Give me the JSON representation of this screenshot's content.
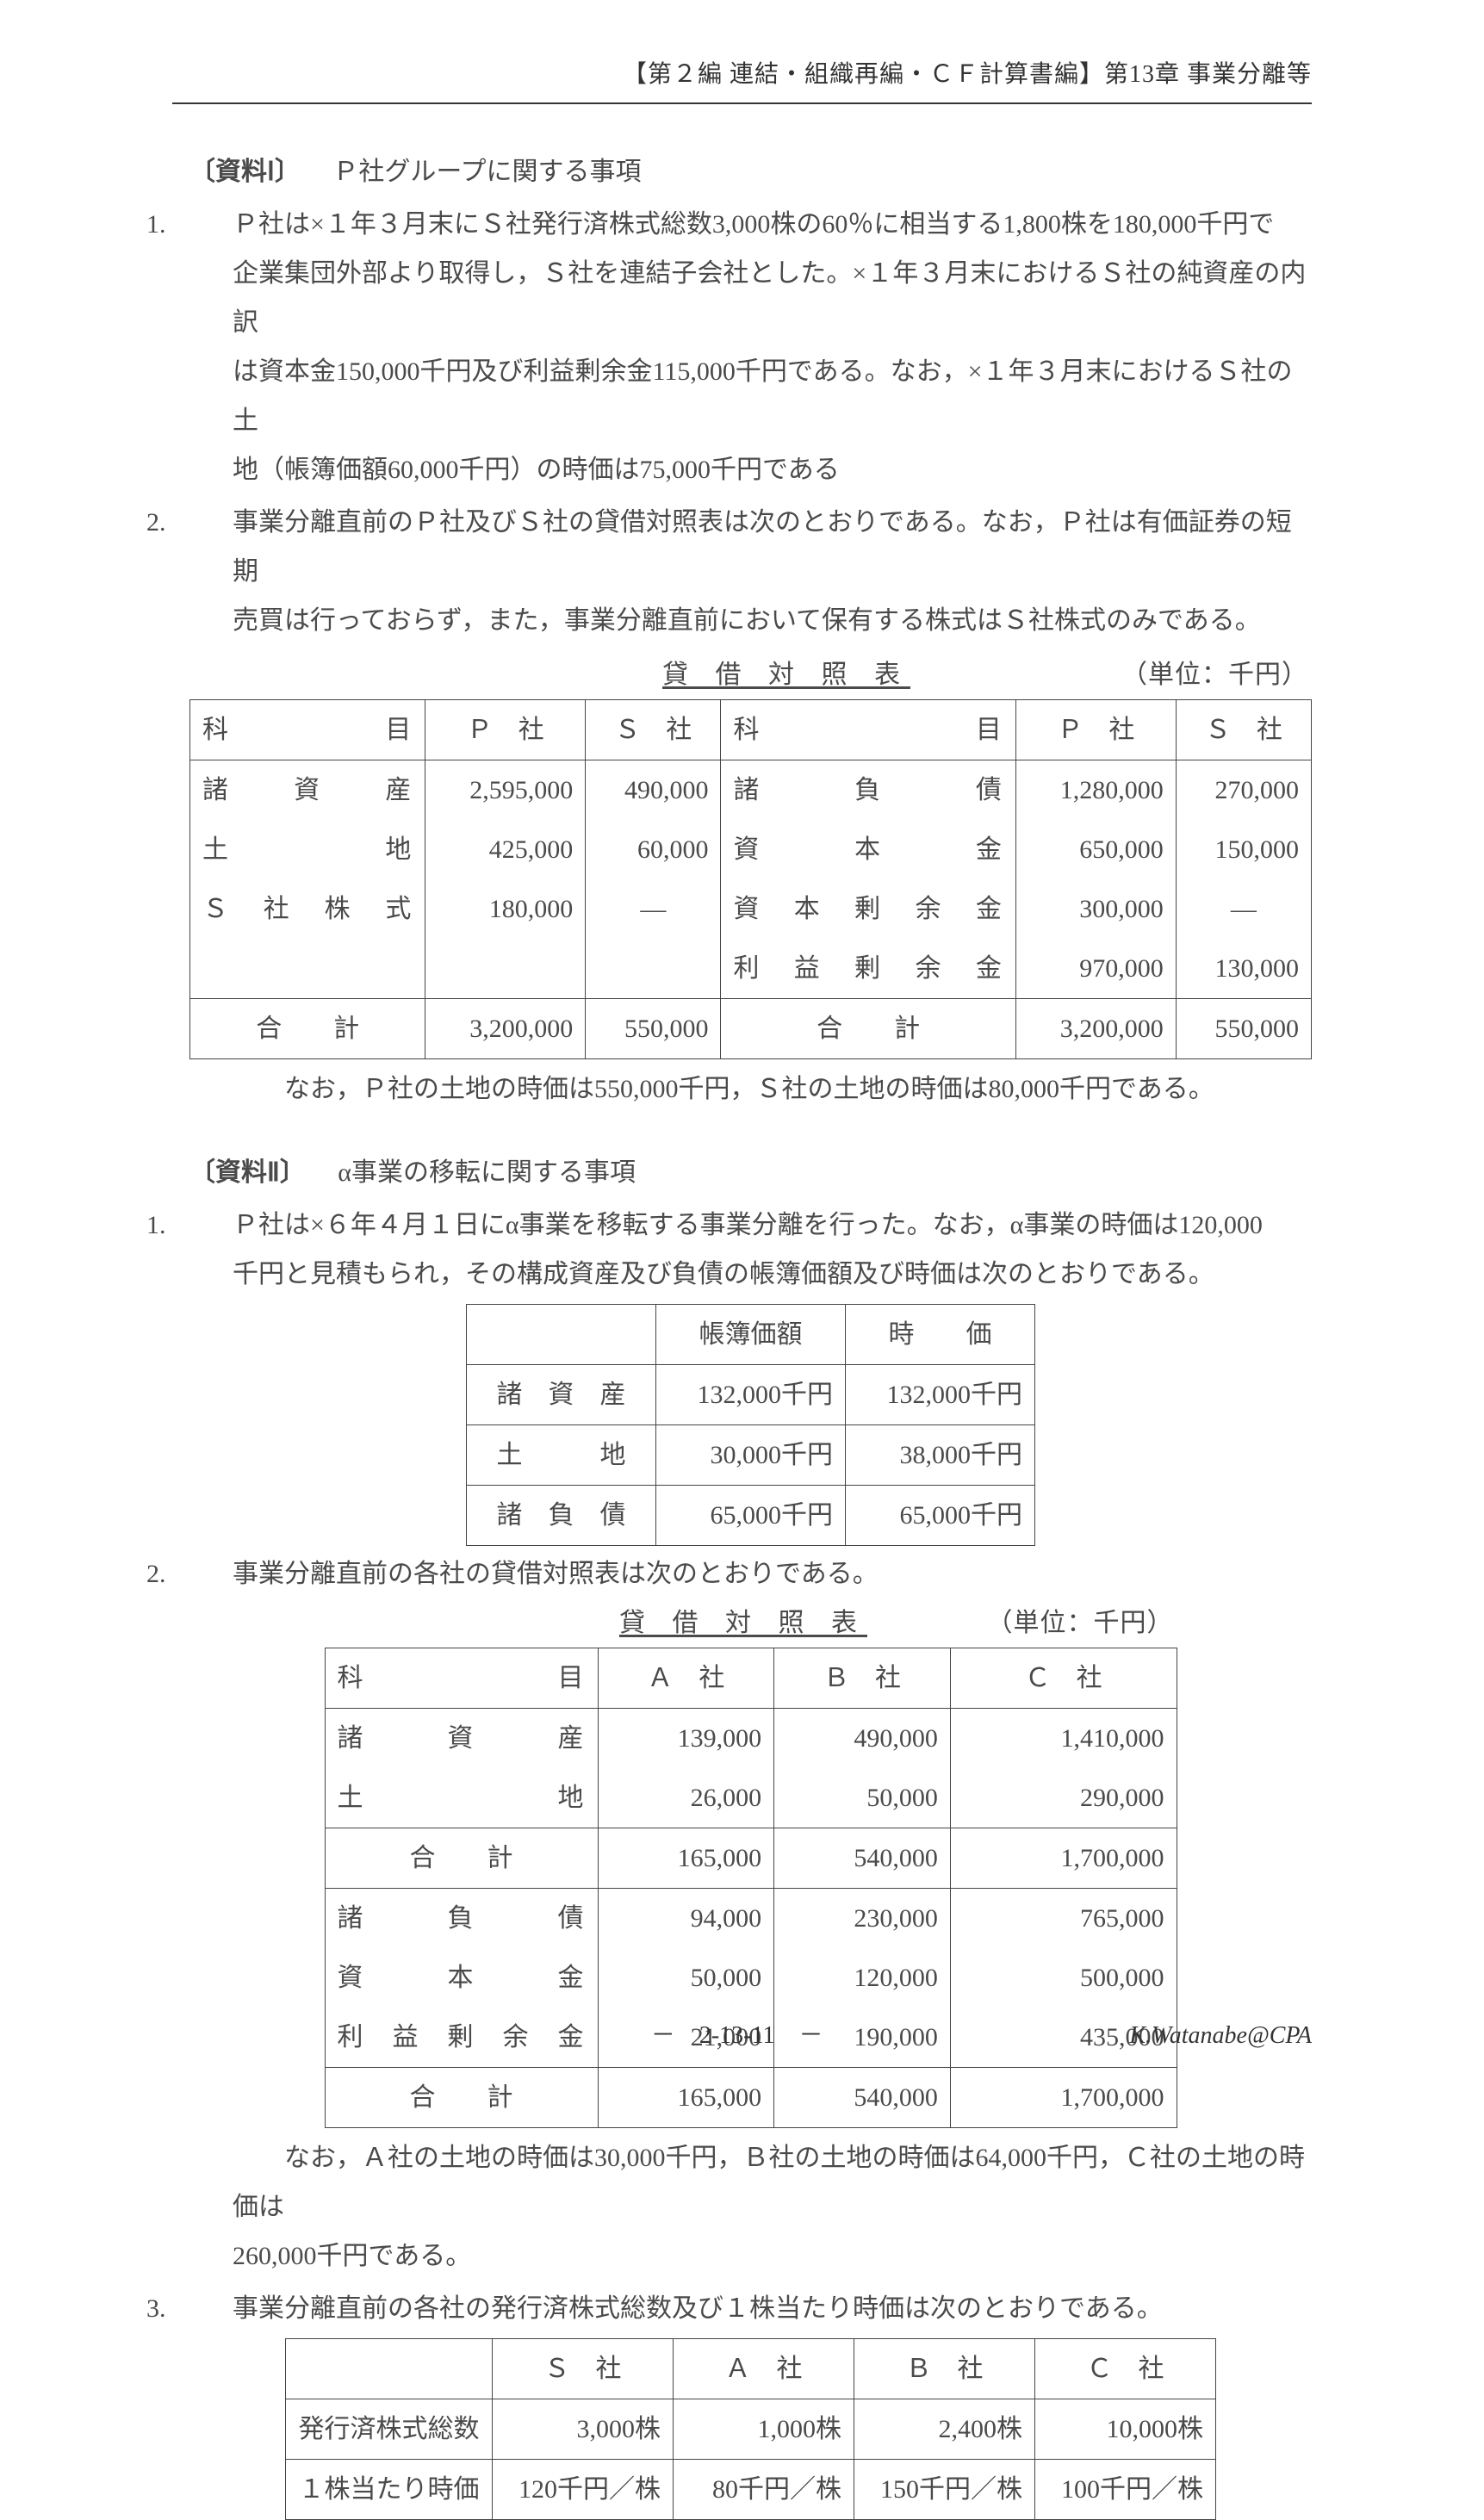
{
  "header": {
    "right": "【第２編 連結・組織再編・ＣＦ計算書編】第13章 事業分離等"
  },
  "sec1": {
    "title_prefix": "〔資料Ⅰ〕",
    "title_body": "Ｐ社グループに関する事項",
    "i1a": "Ｐ社は×１年３月末にＳ社発行済株式総数3,000株の60％に相当する1,800株を180,000千円で",
    "i1b": "企業集団外部より取得し，Ｓ社を連結子会社とした。×１年３月末におけるＳ社の純資産の内訳",
    "i1c": "は資本金150,000千円及び利益剰余金115,000千円である。なお，×１年３月末におけるＳ社の土",
    "i1d": "地（帳簿価額60,000千円）の時価は75,000千円である",
    "i2a": "事業分離直前のＰ社及びＳ社の貸借対照表は次のとおりである。なお，Ｐ社は有価証券の短期",
    "i2b": "売買は行っておらず，また，事業分離直前において保有する株式はＳ社株式のみである。",
    "note": "なお，Ｐ社の土地の時価は550,000千円，Ｓ社の土地の時価は80,000千円である。"
  },
  "tbl1": {
    "title": "貸 借 対 照 表",
    "unit": "（単位：千円）",
    "h_kamoku": "科　　目",
    "h_p": "Ｐ　社",
    "h_s": "Ｓ　社",
    "r1l": "諸　　資　　産",
    "r1p": "2,595,000",
    "r1s": "490,000",
    "r1rl": "諸　　負　　債",
    "r1rp": "1,280,000",
    "r1rs": "270,000",
    "r2l": "土　　　　　地",
    "r2p": "425,000",
    "r2s": "60,000",
    "r2rl": "資　　本　　金",
    "r2rp": "650,000",
    "r2rs": "150,000",
    "r3l": "Ｓ　社　株　式",
    "r3p": "180,000",
    "r3s": "―",
    "r3rl": "資　本　剰　余　金",
    "r3rp": "300,000",
    "r3rs": "―",
    "r4rl": "利　益　剰　余　金",
    "r4rp": "970,000",
    "r4rs": "130,000",
    "r5l": "合　　計",
    "r5p": "3,200,000",
    "r5s": "550,000",
    "r5rl": "合　　計",
    "r5rp": "3,200,000",
    "r5rs": "550,000"
  },
  "sec2": {
    "title_prefix": "〔資料Ⅱ〕",
    "title_body": "α事業の移転に関する事項",
    "i1a": "Ｐ社は×６年４月１日にα事業を移転する事業分離を行った。なお，α事業の時価は120,000",
    "i1b": "千円と見積もられ，その構成資産及び負債の帳簿価額及び時価は次のとおりである。",
    "i2": "事業分離直前の各社の貸借対照表は次のとおりである。",
    "note2a": "なお，Ａ社の土地の時価は30,000千円，Ｂ社の土地の時価は64,000千円，Ｃ社の土地の時価は",
    "note2b": "260,000千円である。",
    "i3": "事業分離直前の各社の発行済株式総数及び１株当たり時価は次のとおりである。"
  },
  "tbl2": {
    "h_book": "帳簿価額",
    "h_fair": "時　　価",
    "r1l": "諸　資　産",
    "r1b": "132,000千円",
    "r1f": "132,000千円",
    "r2l": "土　　　地",
    "r2b": "30,000千円",
    "r2f": "38,000千円",
    "r3l": "諸　負　債",
    "r3b": "65,000千円",
    "r3f": "65,000千円"
  },
  "tbl3": {
    "title": "貸 借 対 照 表",
    "unit": "（単位：千円）",
    "h_kamoku": "科　　目",
    "h_a": "Ａ　社",
    "h_b": "Ｂ　社",
    "h_c": "Ｃ　社",
    "r1l": "諸　　資　　産",
    "r1a": "139,000",
    "r1b": "490,000",
    "r1c": "1,410,000",
    "r2l": "土　　　　　地",
    "r2a": "26,000",
    "r2b": "50,000",
    "r2c": "290,000",
    "r3l": "合　　計",
    "r3a": "165,000",
    "r3b": "540,000",
    "r3c": "1,700,000",
    "r4l": "諸　　負　　債",
    "r4a": "94,000",
    "r4b": "230,000",
    "r4c": "765,000",
    "r5l": "資　　本　　金",
    "r5a": "50,000",
    "r5b": "120,000",
    "r5c": "500,000",
    "r6l": "利　益　剰　余　金",
    "r6a": "21,000",
    "r6b": "190,000",
    "r6c": "435,000",
    "r7l": "合　　計",
    "r7a": "165,000",
    "r7b": "540,000",
    "r7c": "1,700,000"
  },
  "tbl4": {
    "h_s": "Ｓ　社",
    "h_a": "Ａ　社",
    "h_b": "Ｂ　社",
    "h_c": "Ｃ　社",
    "r1l": "発行済株式総数",
    "r1s": "3,000株",
    "r1a": "1,000株",
    "r1b": "2,400株",
    "r1c": "10,000株",
    "r2l": "１株当たり時価",
    "r2s": "120千円／株",
    "r2a": "80千円／株",
    "r2b": "150千円／株",
    "r2c": "100千円／株"
  },
  "footer": {
    "page": "－　2-13-11　－",
    "author": "K.Watanabe@CPA"
  }
}
